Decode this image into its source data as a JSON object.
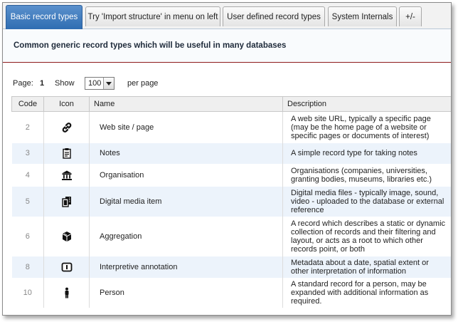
{
  "tabs": [
    {
      "label": "Basic record types",
      "active": true
    },
    {
      "label": "Try 'Import structure' in menu on left",
      "active": false
    },
    {
      "label": "User defined record types",
      "active": false
    },
    {
      "label": "System Internals",
      "active": false
    },
    {
      "label": "+/-",
      "active": false
    }
  ],
  "section_title": "Common generic record types which will be useful in many databases",
  "pager": {
    "page_label": "Page:",
    "page_number": "1",
    "show_label": "Show",
    "page_size": "100",
    "per_page_label": "per page"
  },
  "table": {
    "headers": {
      "code": "Code",
      "icon": "Icon",
      "name": "Name",
      "description": "Description"
    },
    "rows": [
      {
        "code": "2",
        "icon": "link-icon",
        "name": "Web site / page",
        "description": "A web site URL, typically a specific page (may be the home page of a website or specific pages or documents of interest)"
      },
      {
        "code": "3",
        "icon": "notes-icon",
        "name": "Notes",
        "description": "A simple record type for taking notes"
      },
      {
        "code": "4",
        "icon": "building-icon",
        "name": "Organisation",
        "description": "Organisations (companies, universities, granting bodies, museums, libraries etc.)"
      },
      {
        "code": "5",
        "icon": "media-icon",
        "name": "Digital media item",
        "description": "Digital media files - typically image, sound, video - uploaded to the database or external reference"
      },
      {
        "code": "6",
        "icon": "aggregation-icon",
        "name": "Aggregation",
        "description": "A record which describes a static or dynamic collection of records and their filtering and layout, or acts as a root to which other records point, or both"
      },
      {
        "code": "8",
        "icon": "annotation-icon",
        "name": "Interpretive annotation",
        "description": "Metadata about a date, spatial extent or other interpretation of information"
      },
      {
        "code": "10",
        "icon": "person-icon",
        "name": "Person",
        "description": "A standard record for a person, may be expanded with additional information as required."
      }
    ]
  }
}
